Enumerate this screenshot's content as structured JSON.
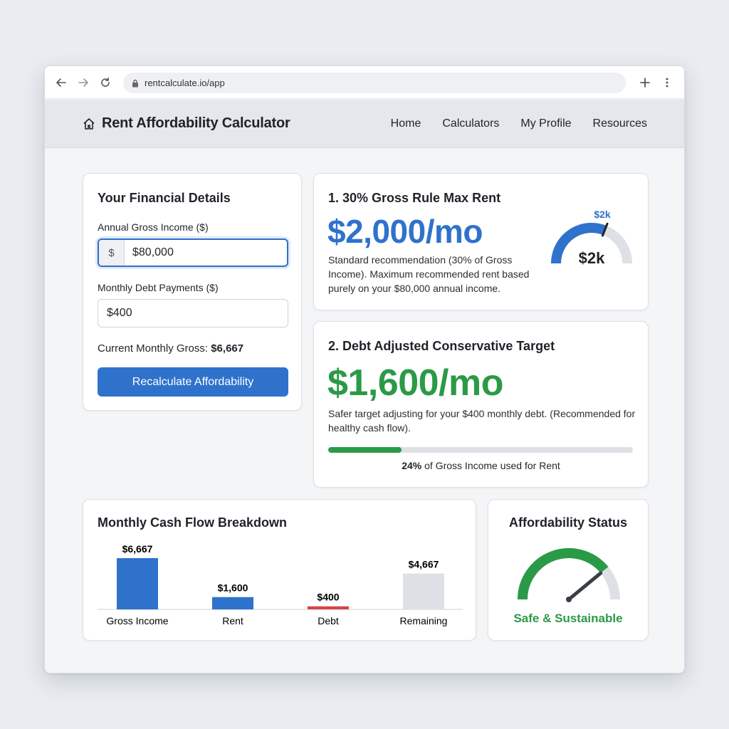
{
  "browser": {
    "url": "rentcalculate.io/app"
  },
  "app": {
    "title": "Rent Affordability Calculator",
    "nav": [
      "Home",
      "Calculators",
      "My Profile",
      "Resources"
    ]
  },
  "details": {
    "title": "Your Financial Details",
    "income_label": "Annual Gross Income ($)",
    "income_prefix": "$",
    "income_value": "$80,000",
    "debt_label": "Monthly Debt Payments ($)",
    "debt_value": "$400",
    "monthly_gross_label": "Current Monthly Gross:",
    "monthly_gross_value": "$6,667",
    "recalc_label": "Recalculate Affordability"
  },
  "rule30": {
    "title": "1. 30% Gross Rule Max Rent",
    "amount": "$2,000/mo",
    "description": "Standard recommendation (30% of Gross Income). Maximum recommended rent based purely on your $80,000 annual income.",
    "gauge_top_label": "$2k",
    "gauge_center_label": "$2k",
    "gauge_fraction": 0.62
  },
  "debt_adjusted": {
    "title": "2. Debt Adjusted Conservative Target",
    "amount": "$1,600/mo",
    "description": "Safer target adjusting for your $400 monthly debt. (Recommended for healthy cash flow).",
    "progress_percent": 24,
    "progress_pct_text": "24%",
    "progress_caption": "of Gross Income used for Rent"
  },
  "cashflow": {
    "title": "Monthly Cash Flow Breakdown"
  },
  "chart_data": {
    "type": "bar",
    "title": "Monthly Cash Flow Breakdown",
    "categories": [
      "Gross Income",
      "Rent",
      "Debt",
      "Remaining"
    ],
    "values": [
      6667,
      1600,
      400,
      4667
    ],
    "value_labels": [
      "$6,667",
      "$1,600",
      "$400",
      "$4,667"
    ],
    "colors": [
      "#2f72cc",
      "#2f72cc",
      "#d64545",
      "#dde1e6"
    ],
    "xlabel": "",
    "ylabel": "",
    "ylim": [
      0,
      6667
    ],
    "grid": false
  },
  "status": {
    "title": "Affordability Status",
    "text": "Safe & Sustainable",
    "gauge_fraction": 0.78
  },
  "colors": {
    "primary_blue": "#2f72cc",
    "green": "#2b9a47",
    "red": "#d64545",
    "track_gray": "#dde1e6"
  },
  "icons": {
    "back": "arrow-left-icon",
    "forward": "arrow-right-icon",
    "reload": "reload-icon",
    "lock": "lock-icon",
    "new_tab": "plus-icon",
    "menu": "kebab-menu-icon",
    "home": "home-icon"
  }
}
